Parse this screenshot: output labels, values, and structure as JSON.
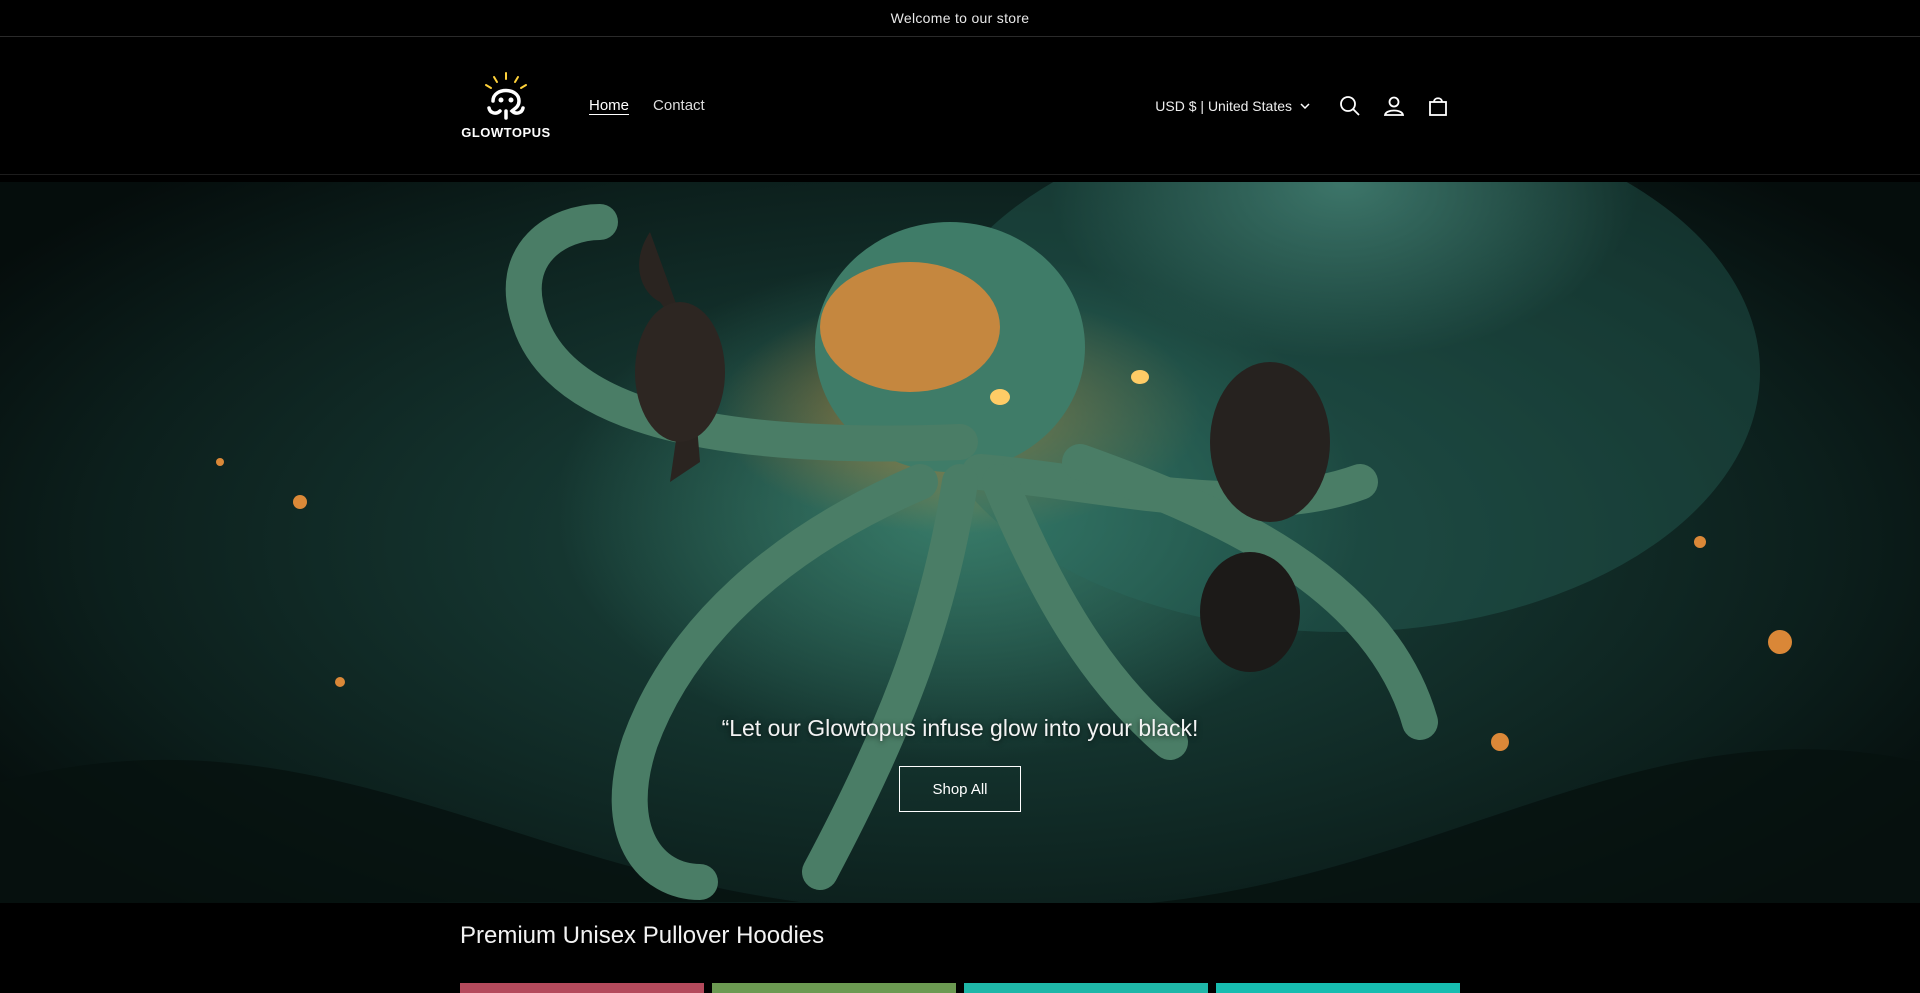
{
  "announcement": {
    "text": "Welcome to our store"
  },
  "header": {
    "logo_text": "GLOWTOPUS",
    "nav": [
      {
        "label": "Home"
      },
      {
        "label": "Contact"
      }
    ],
    "currency_label": "USD $ | United States",
    "icons": [
      "search-icon",
      "account-icon",
      "cart-icon"
    ]
  },
  "hero": {
    "tagline": "“Let our Glowtopus infuse glow into your black!",
    "button_label": "Shop All"
  },
  "collection": {
    "title": "Premium Unisex Pullover Hoodies",
    "card_colors": [
      "#b44a5c",
      "#6c9a52",
      "#1fb7a8",
      "#17bdb0"
    ]
  },
  "colors": {
    "background": "#000000",
    "glow": "#ff8c28",
    "sea": "#1d4a42"
  }
}
